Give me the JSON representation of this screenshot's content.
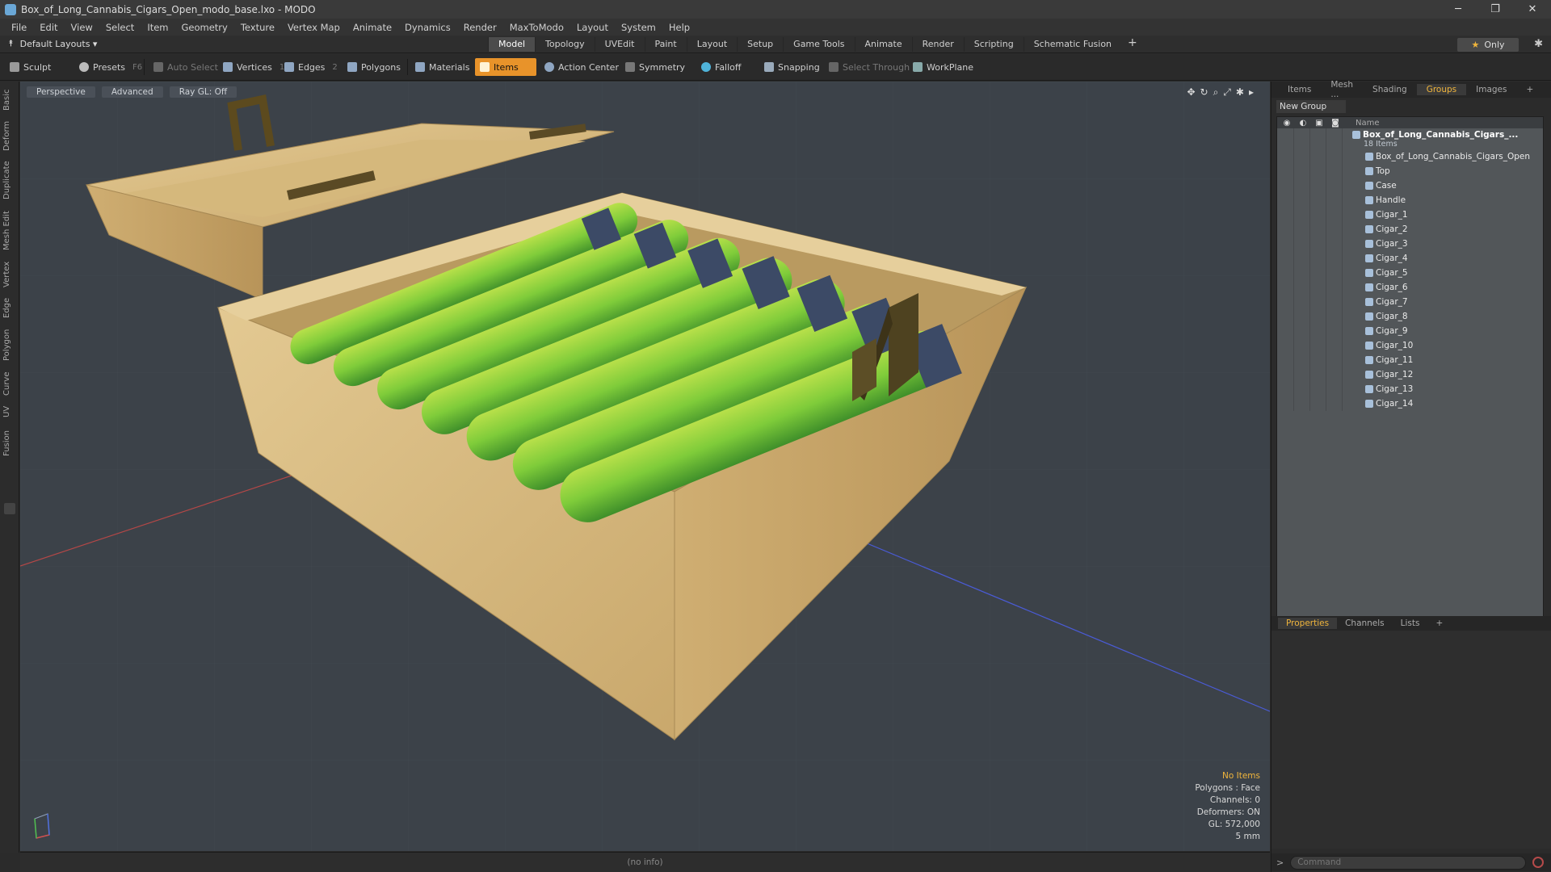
{
  "window": {
    "title": "Box_of_Long_Cannabis_Cigars_Open_modo_base.lxo - MODO",
    "controls": [
      "─",
      "❐",
      "✕"
    ]
  },
  "menu": [
    "File",
    "Edit",
    "View",
    "Select",
    "Item",
    "Geometry",
    "Texture",
    "Vertex Map",
    "Animate",
    "Dynamics",
    "Render",
    "MaxToModo",
    "Layout",
    "System",
    "Help"
  ],
  "modebar": {
    "layouts": "Default Layouts ▾",
    "tabs": [
      "Model",
      "Topology",
      "UVEdit",
      "Paint",
      "Layout",
      "Setup",
      "Game Tools",
      "Animate",
      "Render",
      "Scripting",
      "Schematic Fusion"
    ],
    "active_tab": "Model",
    "only": "Only"
  },
  "toolbar": {
    "sculpt": "Sculpt",
    "presets": "Presets",
    "presets_key": "F6",
    "auto_select": "Auto Select",
    "vertices": "Vertices",
    "vertices_key": "1",
    "edges": "Edges",
    "edges_key": "2",
    "polygons": "Polygons",
    "materials": "Materials",
    "items": "Items",
    "action_center": "Action Center",
    "symmetry": "Symmetry",
    "falloff": "Falloff",
    "snapping": "Snapping",
    "select_through": "Select Through",
    "workplane": "WorkPlane"
  },
  "left_strip": [
    "Basic",
    "Deform",
    "Duplicate",
    "Mesh Edit",
    "Vertex",
    "Edge",
    "Polygon",
    "Curve",
    "UV",
    "Fusion"
  ],
  "viewport": {
    "view": "Perspective",
    "shading": "Advanced",
    "raygl": "Ray GL: Off",
    "stats": {
      "selection": "No Items",
      "polygons": "Polygons : Face",
      "channels": "Channels: 0",
      "deformers": "Deformers: ON",
      "gl": "GL: 572,000",
      "unit": "5 mm"
    }
  },
  "status": "(no info)",
  "right_panel": {
    "tabs": [
      "Items",
      "Mesh ...",
      "Shading",
      "Groups",
      "Images"
    ],
    "active_tab": "Groups",
    "new_group": "New Group",
    "column_name": "Name",
    "group_name": "Box_of_Long_Cannabis_Cigars_...",
    "group_count": "18 Items",
    "items": [
      "Box_of_Long_Cannabis_Cigars_Open",
      "Top",
      "Case",
      "Handle",
      "Cigar_1",
      "Cigar_2",
      "Cigar_3",
      "Cigar_4",
      "Cigar_5",
      "Cigar_6",
      "Cigar_7",
      "Cigar_8",
      "Cigar_9",
      "Cigar_10",
      "Cigar_11",
      "Cigar_12",
      "Cigar_13",
      "Cigar_14"
    ],
    "props_tabs": [
      "Properties",
      "Channels",
      "Lists"
    ],
    "props_active": "Properties",
    "command_placeholder": "Command"
  },
  "colors": {
    "accent": "#e8932a",
    "highlight_text": "#f0b53c",
    "viewport_bg": "#3c4249"
  }
}
